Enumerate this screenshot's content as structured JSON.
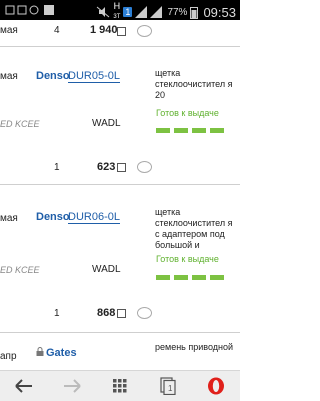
{
  "status_bar": {
    "net_label": "H",
    "net_sub": "3T",
    "sim_badge": "1",
    "battery_pct": "77%",
    "time": "09:53"
  },
  "orders": [
    {
      "month": "мая",
      "qty": "4",
      "price": "1 940"
    },
    {
      "month": "мая",
      "brand": "Denso",
      "part": "DUR05-0L",
      "description": "щетка стеклоочистител я 20",
      "status": "Готов к выдаче",
      "italic_text": "ED KCEE",
      "supplier_code": "WADL",
      "qty": "1",
      "price": "623"
    },
    {
      "month": "мая",
      "brand": "Denso",
      "part": "DUR06-0L",
      "description": "щетка стеклоочистител я с адаптером под большой и",
      "status": "Готов к выдаче",
      "italic_text": "ED KCEE",
      "supplier_code": "WADL",
      "qty": "1",
      "price": "868"
    },
    {
      "month": "апр",
      "brand": "Gates",
      "description": "ремень приводной"
    }
  ],
  "colors": {
    "link": "#1f5ea8",
    "ready_green": "#5fb12e",
    "opera_red": "#e0201b"
  },
  "nav_icons": [
    "back-icon",
    "forward-icon",
    "speed-dial-icon",
    "tabs-icon",
    "opera-menu-icon"
  ],
  "tabs_count": "1"
}
